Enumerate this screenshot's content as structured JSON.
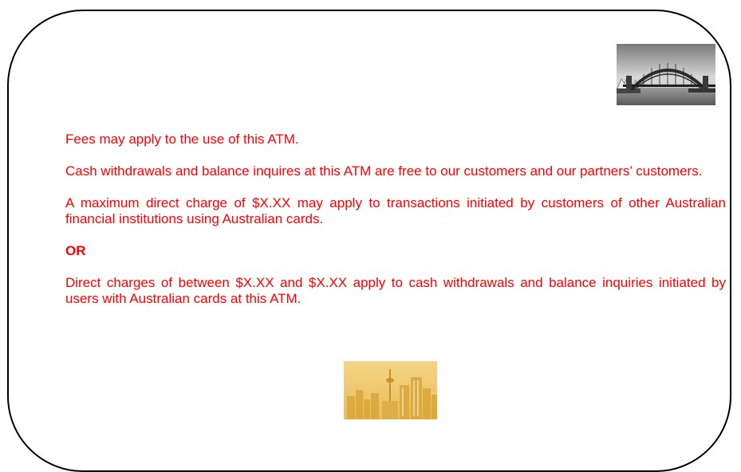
{
  "notice": {
    "fees_line": "Fees may apply to the use of this ATM.",
    "free_line": "Cash withdrawals and balance inquires at this ATM are free to our customers and our partners’ customers.",
    "max_charge_line": "A maximum direct charge of $X.XX may apply to transactions initiated by customers of other Australian financial institutions using Australian cards.",
    "or_label": "OR",
    "range_line": "Direct charges of between $X.XX and $X.XX apply to cash withdrawals and balance inquiries initiated by users with Australian cards at this ATM."
  },
  "images": {
    "top_right": "harbour-bridge-photo",
    "bottom_center": "city-skyline-photo"
  },
  "colors": {
    "text": "#ff0000",
    "border": "#000000",
    "bridge_tint": "#6f6f6f",
    "skyline_tint": "#e6b545"
  }
}
